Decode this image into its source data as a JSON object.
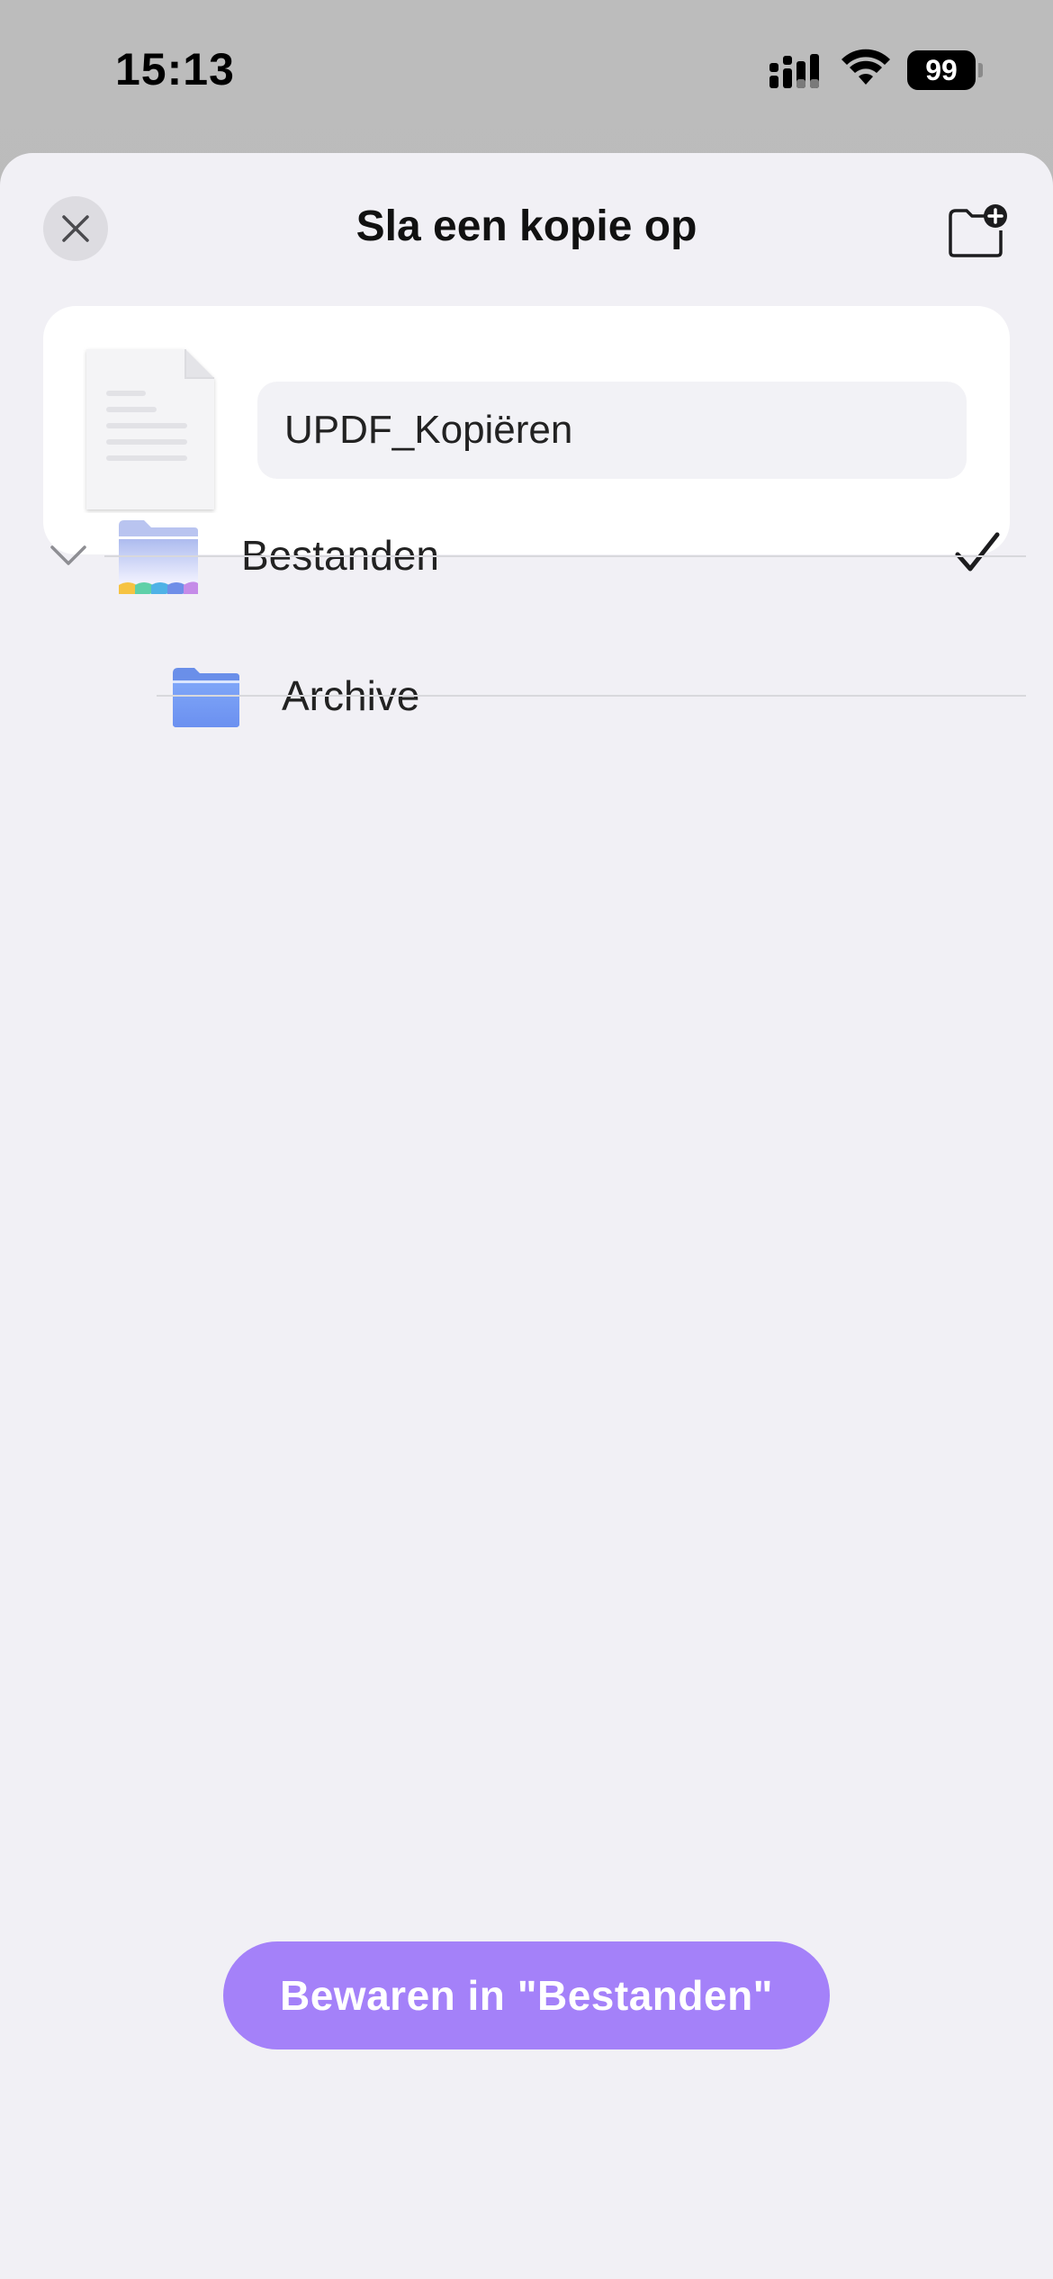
{
  "status_bar": {
    "time": "15:13",
    "battery": "99"
  },
  "sheet": {
    "title": "Sla een kopie op",
    "file_name": "UPDF_Kopiëren"
  },
  "folders": [
    {
      "label": "Bestanden",
      "selected": true,
      "expanded": true,
      "icon": "files-app-folder-icon"
    },
    {
      "label": "Archive",
      "selected": false,
      "icon": "folder-icon"
    }
  ],
  "actions": {
    "save_label": "Bewaren in \"Bestanden\""
  },
  "colors": {
    "accent": "#a481f9",
    "sheet_bg": "#f1f0f5"
  }
}
